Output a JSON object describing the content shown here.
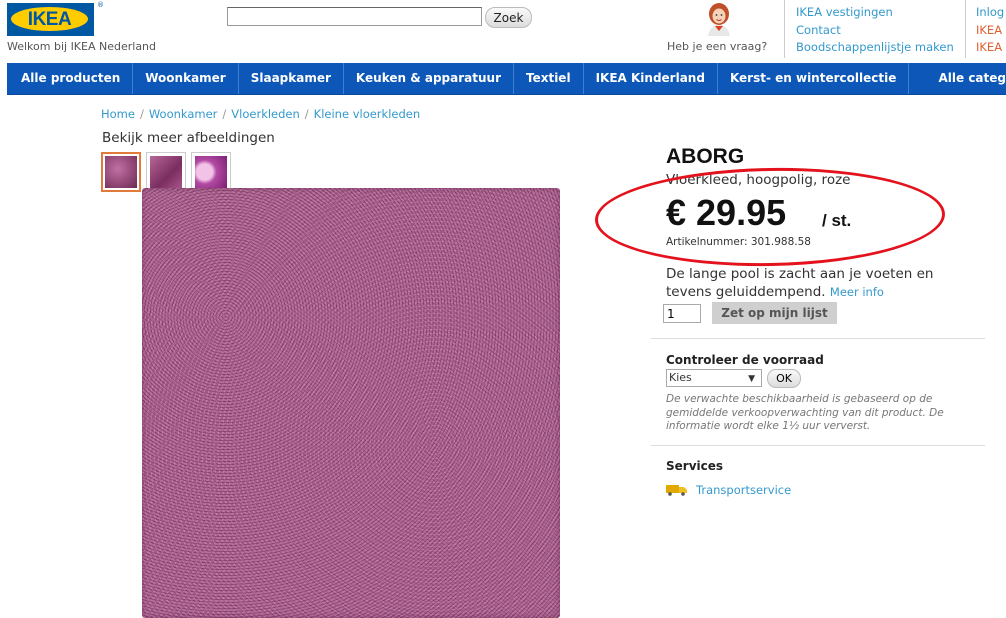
{
  "brand": {
    "logo_text": "IKEA",
    "welcome": "Welkom bij IKEA Nederland"
  },
  "search": {
    "placeholder": "",
    "button": "Zoek"
  },
  "help": {
    "text": "Heb je een vraag?"
  },
  "header_links": [
    "IKEA vestigingen",
    "Contact",
    "Boodschappenlijstje maken"
  ],
  "header_links_right": [
    "Inlog",
    "IKEA",
    "IKEA"
  ],
  "nav": [
    "Alle producten",
    "Woonkamer",
    "Slaapkamer",
    "Keuken & apparatuur",
    "Textiel",
    "IKEA Kinderland",
    "Kerst- en wintercollectie",
    "Alle categ"
  ],
  "breadcrumb": [
    "Home",
    "Woonkamer",
    "Vloerkleden",
    "Kleine vloerkleden"
  ],
  "gallery": {
    "heading": "Bekijk meer afbeeldingen",
    "thumbnails": 3
  },
  "product": {
    "name": "ABORG",
    "subtitle": "Vloerkleed, hoogpolig, roze",
    "price": "€ 29.95",
    "unit": "/ st.",
    "article_number": "Artikelnummer: 301.988.58",
    "description": "De lange pool is zacht aan je voeten en tevens geluiddempend.",
    "more_info": "Meer info",
    "quantity": "1",
    "add_button": "Zet op mijn lijst"
  },
  "stock": {
    "title": "Controleer de voorraad",
    "select_value": "Kies",
    "ok": "OK",
    "note": "De verwachte beschikbaarheid is gebaseerd op de gemiddelde verkoopverwachting van dit product. De informatie wordt elke 1½ uur ververst."
  },
  "services": {
    "title": "Services",
    "transport": "Transportservice"
  },
  "colors": {
    "nav_bg": "#0d57b8",
    "link": "#3399cc",
    "highlight_circle": "#e3121c",
    "brand_blue": "#0058a3",
    "brand_yellow": "#ffcc00"
  }
}
